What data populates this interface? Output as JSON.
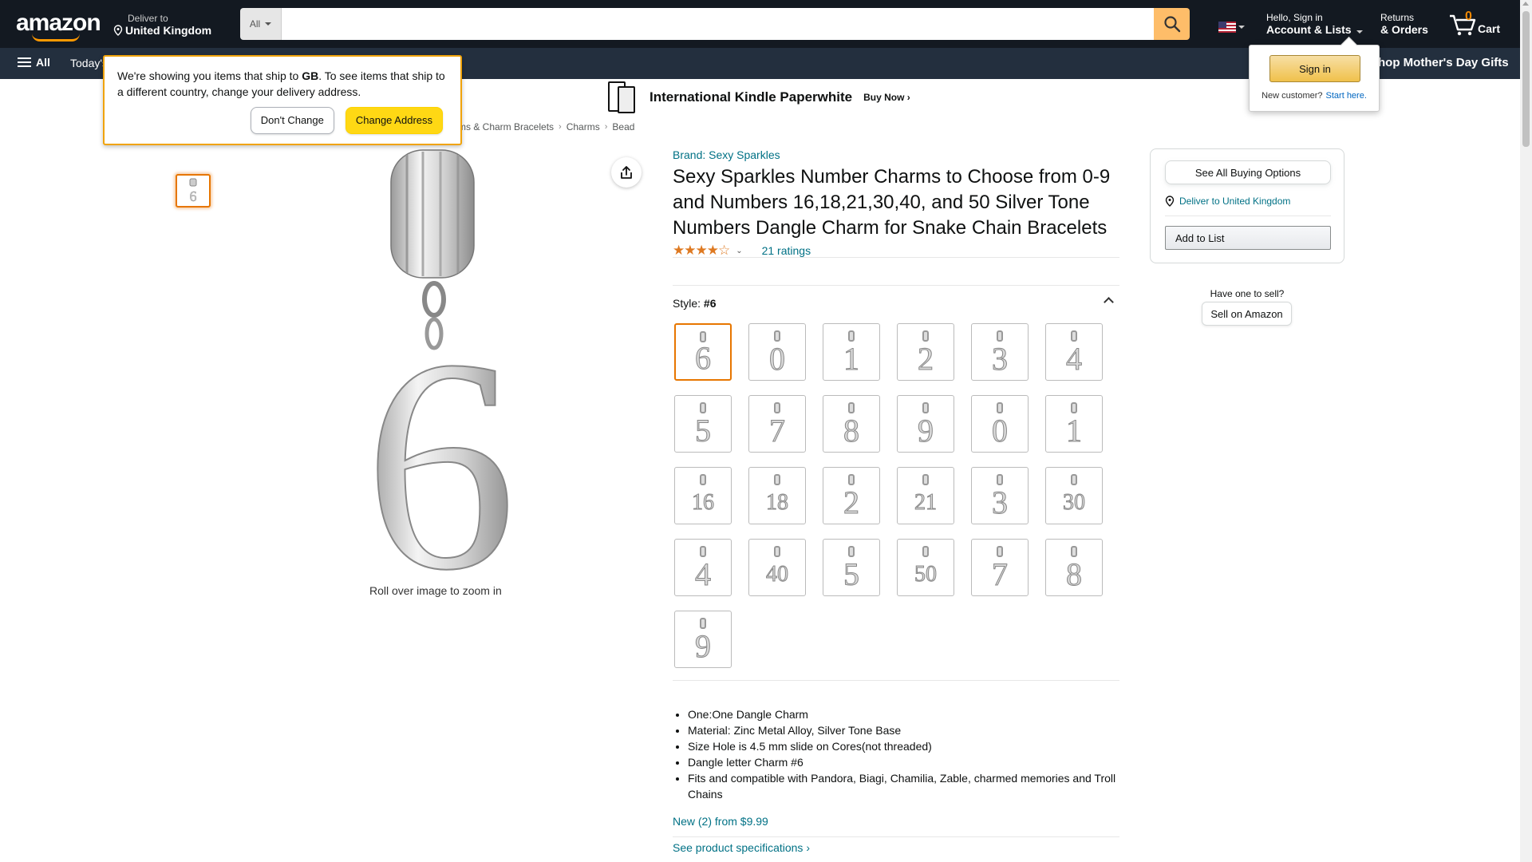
{
  "nav": {
    "logo_text": "amazon",
    "deliver_line1": "Deliver to",
    "deliver_line2": "United Kingdom",
    "search_category": "All",
    "search_placeholder": "",
    "account_line1": "Hello, Sign in",
    "account_line2": "Account & Lists",
    "returns_line1": "Returns",
    "returns_line2": "& Orders",
    "cart_count": "0",
    "cart_label": "Cart"
  },
  "subnav": {
    "all_label": "All",
    "today_label": "Today's",
    "mothers_day": "Shop Mother's Day Gifts"
  },
  "promo": {
    "title": "International Kindle Paperwhite",
    "cta": "Buy Now ›"
  },
  "breadcrumb": [
    "ms & Charm Bracelets",
    "Charms",
    "Bead"
  ],
  "ship_popover": {
    "text_before": "We're showing you items that ship to ",
    "country": "GB",
    "text_after": ". To see items that ship to a different country, change your delivery address.",
    "dont_change": "Don't Change",
    "change_address": "Change Address"
  },
  "signin_popover": {
    "button": "Sign in",
    "new_customer": "New customer?",
    "start_here": "Start here."
  },
  "gallery": {
    "zoom_hint": "Roll over image to zoom in"
  },
  "product": {
    "brand": "Brand: Sexy Sparkles",
    "title": "Sexy Sparkles Number Charms to Choose from 0-9 and Numbers 16,18,21,30,40, and 50 Silver Tone Numbers Dangle Charm for Snake Chain Bracelets",
    "stars": "★★★★☆",
    "rating_value": 4.1,
    "ratings_count": "21 ratings",
    "style_label": "Style: ",
    "style_value": "#6",
    "styles": [
      "6",
      "0",
      "1",
      "2",
      "3",
      "4",
      "5",
      "7",
      "8",
      "9",
      "0",
      "1",
      "16",
      "18",
      "2",
      "21",
      "3",
      "30",
      "4",
      "40",
      "5",
      "50",
      "7",
      "8",
      "9"
    ],
    "bullets": [
      "One:One Dangle Charm",
      "Material: Zinc Metal Alloy, Silver Tone Base",
      "Size Hole is 4.5 mm slide on Cores(not threaded)",
      "Dangle letter Charm #6",
      "Fits and compatible with Pandora, Biagi, Chamilia, Zable, charmed memories and Troll Chains"
    ],
    "new_from": "New (2) from $9.99",
    "see_specs": "See product specifications ›"
  },
  "buybox": {
    "see_all": "See All Buying Options",
    "deliver": "Deliver to United Kingdom",
    "add_to_list": "Add to List"
  },
  "sell": {
    "have_one": "Have one to sell?",
    "sell_button": "Sell on Amazon"
  },
  "colors": {
    "nav_bg": "#131921",
    "subnav_bg": "#232f3e",
    "accent_orange": "#ff9900",
    "link": "#007185",
    "button_yellow": "#ffd814"
  }
}
